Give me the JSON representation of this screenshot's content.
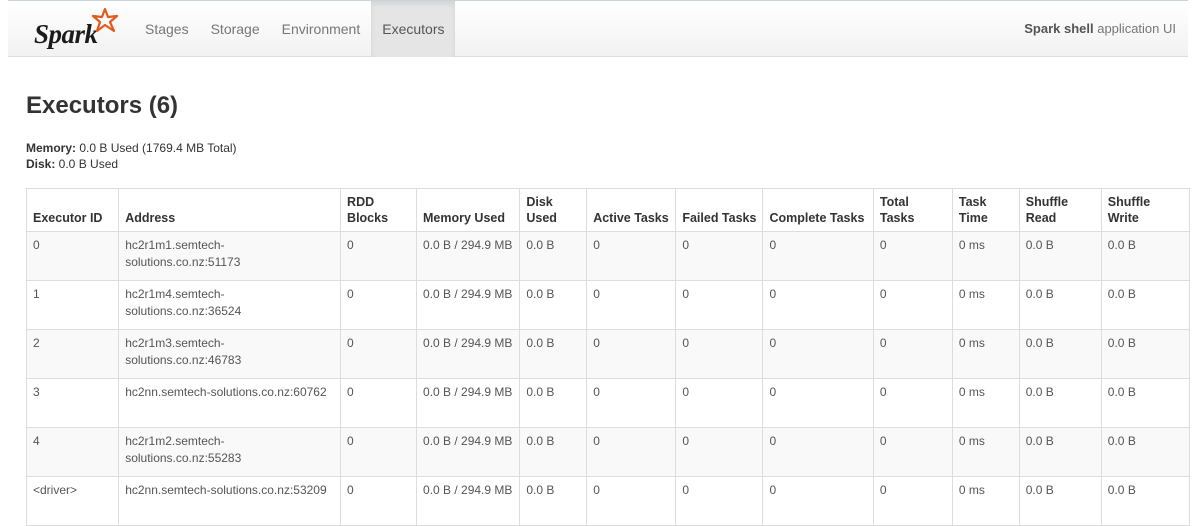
{
  "navbar": {
    "brand": "Spark",
    "tabs": [
      {
        "label": "Stages",
        "active": false
      },
      {
        "label": "Storage",
        "active": false
      },
      {
        "label": "Environment",
        "active": false
      },
      {
        "label": "Executors",
        "active": true
      }
    ],
    "app_name": "Spark shell",
    "app_suffix": " application UI"
  },
  "page": {
    "title": "Executors (6)",
    "memory_label": "Memory:",
    "memory_value": " 0.0 B Used (1769.4 MB Total)",
    "disk_label": "Disk:",
    "disk_value": " 0.0 B Used"
  },
  "table": {
    "headers": [
      "Executor ID",
      "Address",
      "RDD Blocks",
      "Memory Used",
      "Disk Used",
      "Active Tasks",
      "Failed Tasks",
      "Complete Tasks",
      "Total Tasks",
      "Task Time",
      "Shuffle Read",
      "Shuffle Write"
    ],
    "rows": [
      [
        "0",
        "hc2r1m1.semtech-solutions.co.nz:51173",
        "0",
        "0.0 B / 294.9 MB",
        "0.0 B",
        "0",
        "0",
        "0",
        "0",
        "0 ms",
        "0.0 B",
        "0.0 B"
      ],
      [
        "1",
        "hc2r1m4.semtech-solutions.co.nz:36524",
        "0",
        "0.0 B / 294.9 MB",
        "0.0 B",
        "0",
        "0",
        "0",
        "0",
        "0 ms",
        "0.0 B",
        "0.0 B"
      ],
      [
        "2",
        "hc2r1m3.semtech-solutions.co.nz:46783",
        "0",
        "0.0 B / 294.9 MB",
        "0.0 B",
        "0",
        "0",
        "0",
        "0",
        "0 ms",
        "0.0 B",
        "0.0 B"
      ],
      [
        "3",
        "hc2nn.semtech-solutions.co.nz:60762",
        "0",
        "0.0 B / 294.9 MB",
        "0.0 B",
        "0",
        "0",
        "0",
        "0",
        "0 ms",
        "0.0 B",
        "0.0 B"
      ],
      [
        "4",
        "hc2r1m2.semtech-solutions.co.nz:55283",
        "0",
        "0.0 B / 294.9 MB",
        "0.0 B",
        "0",
        "0",
        "0",
        "0",
        "0 ms",
        "0.0 B",
        "0.0 B"
      ],
      [
        "<driver>",
        "hc2nn.semtech-solutions.co.nz:53209",
        "0",
        "0.0 B / 294.9 MB",
        "0.0 B",
        "0",
        "0",
        "0",
        "0",
        "0 ms",
        "0.0 B",
        "0.0 B"
      ]
    ]
  },
  "colors": {
    "star": "#e25a1c",
    "active_tab_bg": "#e5e5e5",
    "stripe": "#f9f9f9"
  },
  "icons": {
    "brand_logo": "spark-star-logo-icon"
  }
}
